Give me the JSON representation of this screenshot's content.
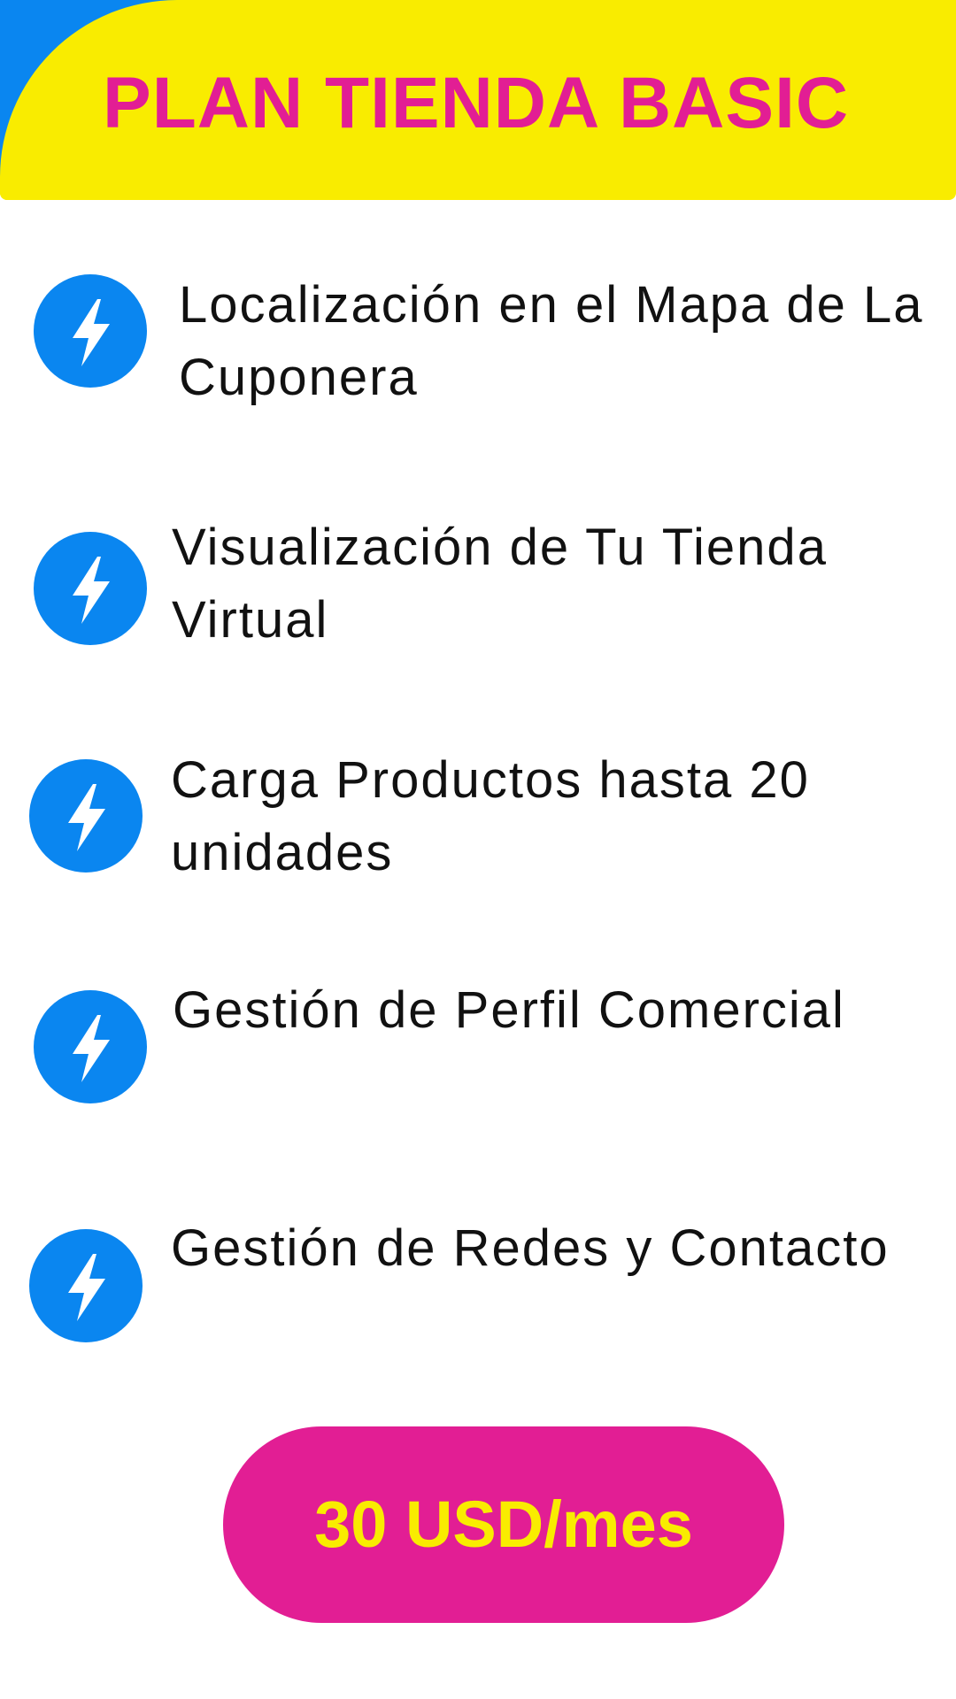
{
  "header": {
    "title": "PLAN TIENDA BASIC"
  },
  "features": [
    {
      "icon": "lightning-bolt-icon",
      "text": "Localización en el Mapa de La Cuponera"
    },
    {
      "icon": "lightning-bolt-icon",
      "text": "Visualización de Tu Tienda Virtual"
    },
    {
      "icon": "lightning-bolt-icon",
      "text": "Carga Productos hasta 20 unidades"
    },
    {
      "icon": "lightning-bolt-icon",
      "text": "Gestión de Perfil Comercial"
    },
    {
      "icon": "lightning-bolt-icon",
      "text": "Gestión de Redes y Contacto"
    }
  ],
  "price": {
    "label": "30 USD/mes"
  },
  "colors": {
    "yellow": "#f9ec00",
    "pink": "#e21e94",
    "blue": "#0a86f0",
    "text": "#111111"
  }
}
